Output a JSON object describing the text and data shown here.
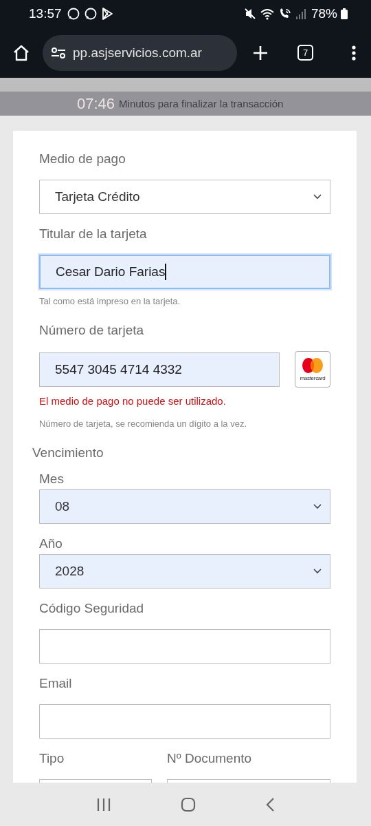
{
  "status_bar": {
    "time": "13:57",
    "battery": "78%"
  },
  "browser": {
    "url": "pp.asjservicios.com.ar",
    "tab_count": "7"
  },
  "timer": {
    "time": "07:46",
    "text": "Minutos para finalizar la transacción"
  },
  "form": {
    "fields": [
      {
        "kind": "select",
        "label": "Medio de pago",
        "value": "Tarjeta Crédito",
        "autofilled": false
      },
      {
        "kind": "text",
        "label": "Titular de la tarjeta",
        "value": "Cesar Dario Farias",
        "autofilled": true,
        "focused": true,
        "hint": "Tal como está impreso en la tarjeta."
      },
      {
        "kind": "card",
        "label": "Número de tarjeta",
        "value": "5547 3045 4714 4332",
        "autofilled": true,
        "brand_label": "mastercard",
        "error": "El medio de pago no puede ser utilizado.",
        "hint": "Número de tarjeta, se recomienda un dígito a la vez."
      },
      {
        "kind": "group",
        "label": "Vencimiento",
        "children": [
          {
            "kind": "select",
            "label": "Mes",
            "value": "08",
            "autofilled": true
          },
          {
            "kind": "select",
            "label": "Año",
            "value": "2028",
            "autofilled": true
          }
        ]
      },
      {
        "kind": "text",
        "label": "Código Seguridad",
        "autofilled": false,
        "focused": false
      },
      {
        "kind": "text",
        "label": "Email",
        "autofilled": false,
        "focused": false
      },
      {
        "kind": "pair",
        "children": [
          {
            "kind": "text",
            "label": "Tipo",
            "autofilled": false,
            "focused": false
          },
          {
            "kind": "text",
            "label": "Nº Documento",
            "autofilled": false,
            "focused": false
          }
        ]
      }
    ]
  }
}
